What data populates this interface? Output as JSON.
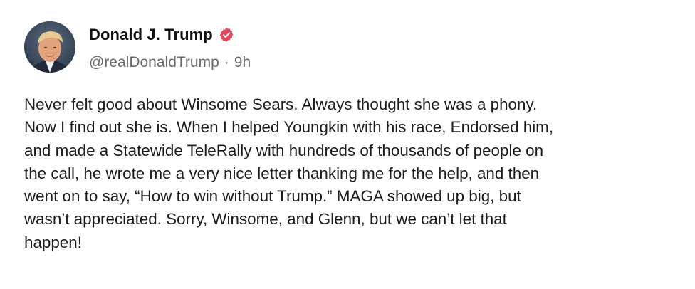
{
  "post": {
    "author_name": "Donald J. Trump",
    "handle": "@realDonaldTrump",
    "separator": "·",
    "time_ago": "9h",
    "verified_icon": "verified-badge-icon",
    "accent_color": "#e8445a",
    "text": "Never felt good about Winsome Sears. Always thought she was a phony.\nNow I find out she is. When I helped Youngkin with his race, Endorsed him,\nand made a Statewide TeleRally with hundreds of thousands of people on\nthe call, he wrote me a very nice letter thanking me for the help, and then\nwent on to say, “How to win without Trump.” MAGA showed up big, but\nwasn’t appreciated. Sorry, Winsome, and Glenn, but we can’t let that\nhappen!"
  }
}
